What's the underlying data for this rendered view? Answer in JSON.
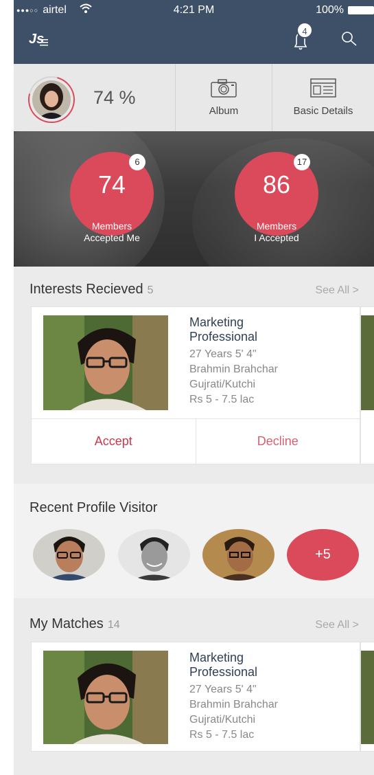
{
  "status_bar": {
    "carrier": "airtel",
    "time": "4:21 PM",
    "battery": "100%"
  },
  "header": {
    "logo": "Js",
    "notification_count": "4",
    "icons": [
      "bell-icon",
      "search-icon"
    ]
  },
  "profile_strip": {
    "completion": "74 %",
    "album_label": "Album",
    "basic_details_label": "Basic Details"
  },
  "stats": [
    {
      "value": "74",
      "badge": "6",
      "label_line1": "Members",
      "label_line2": "Accepted Me"
    },
    {
      "value": "86",
      "badge": "17",
      "label_line1": "Members",
      "label_line2": "I Accepted"
    }
  ],
  "interests": {
    "title": "Interests Recieved",
    "count": "5",
    "see_all": "See All >",
    "card": {
      "title_line1": "Marketing",
      "title_line2": "Professional",
      "age_height": "27 Years   5' 4\"",
      "community": "Brahmin Brahchar",
      "language": "Gujrati/Kutchi",
      "income": "Rs 5 - 7.5 lac",
      "accept": "Accept",
      "decline": "Decline"
    }
  },
  "visitors": {
    "title": "Recent Profile Visitor",
    "more": "+5"
  },
  "matches": {
    "title": "My Matches",
    "count": "14",
    "see_all": "See All >",
    "card": {
      "title_line1": "Marketing",
      "title_line2": "Professional",
      "age_height": "27 Years   5' 4\"",
      "community": "Brahmin Brahchar",
      "language": "Gujrati/Kutchi",
      "income": "Rs 5 - 7.5 lac"
    }
  },
  "colors": {
    "header_bg": "#3e5068",
    "accent_red": "#da4a5b",
    "title_blue": "#2f3f55"
  }
}
